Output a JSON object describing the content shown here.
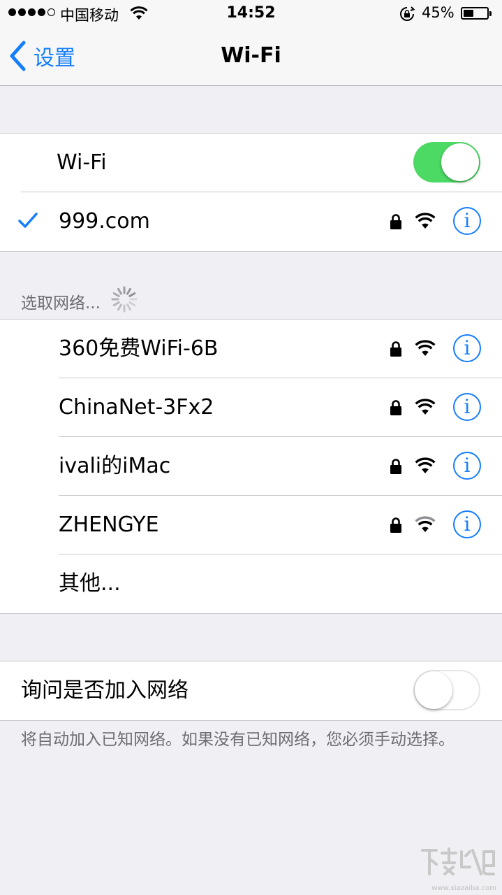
{
  "status_bar": {
    "carrier": "中国移动",
    "time": "14:52",
    "battery_percent": "45%",
    "battery_level": 0.45,
    "signal_bars_filled": 4,
    "signal_bars_total": 5
  },
  "nav": {
    "back_label": "设置",
    "title": "Wi-Fi"
  },
  "wifi_group": {
    "toggle_label": "Wi-Fi",
    "toggle_on": true,
    "connected_network": {
      "name": "999.com",
      "secured": true,
      "signal": "full"
    }
  },
  "networks_section": {
    "header": "选取网络...",
    "networks": [
      {
        "name": "360免费WiFi-6B",
        "secured": true,
        "signal": "full"
      },
      {
        "name": "ChinaNet-3Fx2",
        "secured": true,
        "signal": "full"
      },
      {
        "name": "ivali的iMac",
        "secured": true,
        "signal": "full"
      },
      {
        "name": "ZHENGYE",
        "secured": true,
        "signal": "weak"
      }
    ],
    "other_label": "其他..."
  },
  "ask_join": {
    "label": "询问是否加入网络",
    "toggle_on": false,
    "footer": "将自动加入已知网络。如果没有已知网络，您必须手动选择。"
  },
  "info_glyph": "i",
  "colors": {
    "accent": "#157efb",
    "toggle_on": "#4cd964",
    "background": "#efeff4"
  },
  "watermark": {
    "text": "www.xiazaiba.com"
  }
}
